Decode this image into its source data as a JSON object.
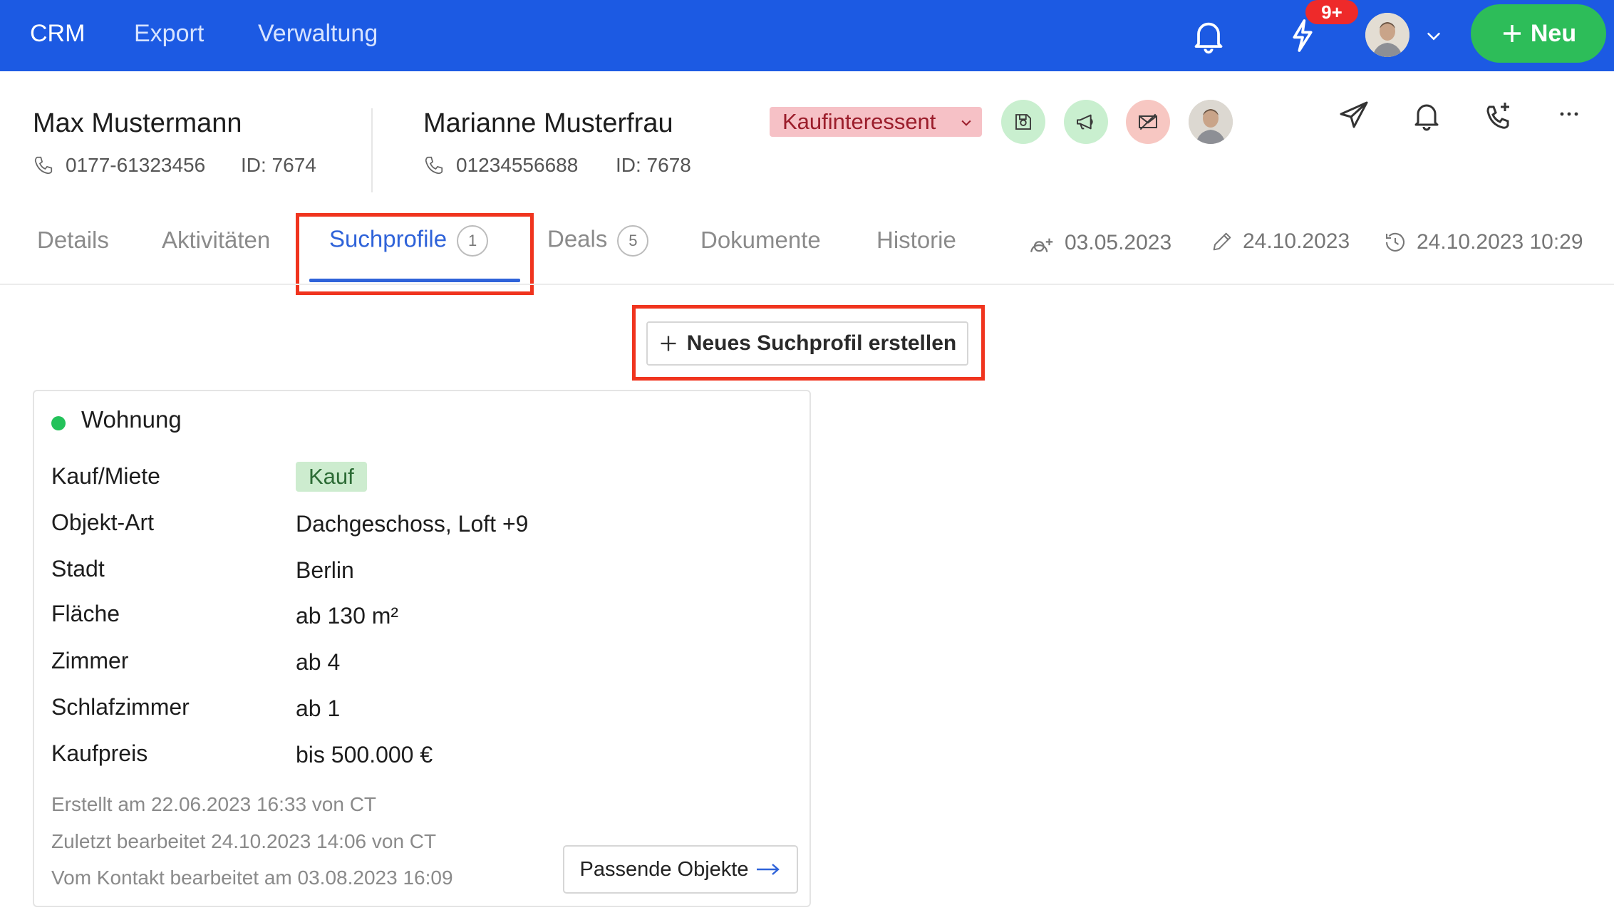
{
  "topnav": {
    "items": [
      "CRM",
      "Export",
      "Verwaltung"
    ],
    "badge": "9+",
    "new_label": "Neu"
  },
  "contacts": [
    {
      "name": "Max Mustermann",
      "phone": "0177-61323456",
      "id": "ID: 7674"
    },
    {
      "name": "Marianne Musterfrau",
      "phone": "01234556688",
      "id": "ID: 7678"
    }
  ],
  "status": {
    "label": "Kaufinteressent"
  },
  "colors": {
    "brand_blue": "#1c5ae3",
    "new_green": "#2dbd59",
    "status_pink": "#f6c1c6",
    "highlight": "#f0341e"
  },
  "tabs": [
    {
      "label": "Details"
    },
    {
      "label": "Aktivitäten"
    },
    {
      "label": "Suchprofile",
      "count": "1"
    },
    {
      "label": "Deals",
      "count": "5"
    },
    {
      "label": "Dokumente"
    },
    {
      "label": "Historie"
    }
  ],
  "meta": {
    "created": "03.05.2023",
    "edited": "24.10.2023",
    "last_activity": "24.10.2023 10:29"
  },
  "actions": {
    "new_profile": "Neues Suchprofil erstellen"
  },
  "profile": {
    "title": "Wohnung",
    "rows": [
      {
        "label": "Kauf/Miete",
        "value": "Kauf"
      },
      {
        "label": "Objekt-Art",
        "value": "Dachgeschoss, Loft +9"
      },
      {
        "label": "Stadt",
        "value": "Berlin"
      },
      {
        "label": "Fläche",
        "value": "ab 130 m²"
      },
      {
        "label": "Zimmer",
        "value": "ab 4"
      },
      {
        "label": "Schlafzimmer",
        "value": "ab 1"
      },
      {
        "label": "Kaufpreis",
        "value": "bis 500.000 €"
      }
    ],
    "footer": [
      "Erstellt am 22.06.2023 16:33 von CT",
      "Zuletzt bearbeitet 24.10.2023 14:06 von CT",
      "Vom Kontakt bearbeitet am 03.08.2023 16:09"
    ],
    "match_label": "Passende Objekte"
  }
}
